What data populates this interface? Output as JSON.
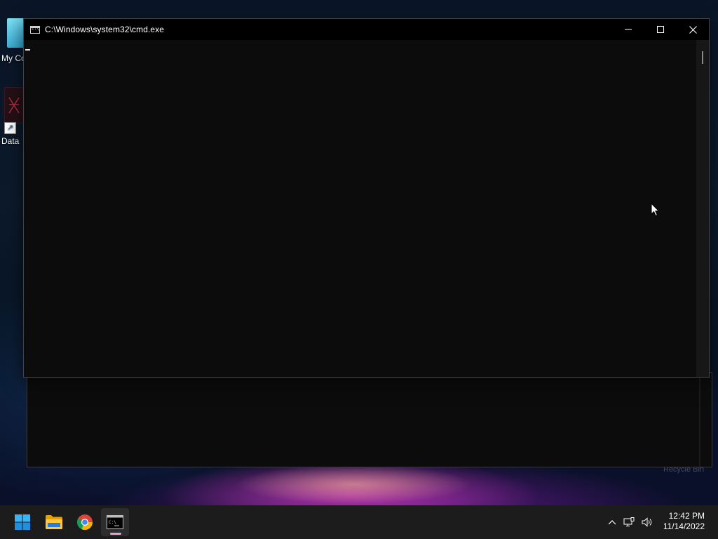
{
  "desktop": {
    "icons": [
      {
        "label": "My Co",
        "icon": "monitor-icon"
      },
      {
        "label": "Data",
        "icon": "database-shortcut-icon"
      }
    ],
    "recycle_bin_label": "Recycle Bin"
  },
  "cmd_window": {
    "title": "C:\\Windows\\system32\\cmd.exe",
    "console_text": "",
    "controls": {
      "minimize": "minimize-icon",
      "maximize": "maximize-icon",
      "close": "close-icon"
    }
  },
  "taskbar": {
    "apps": [
      {
        "name": "Start",
        "icon": "windows-start-icon"
      },
      {
        "name": "File Explorer",
        "icon": "folder-icon"
      },
      {
        "name": "Google Chrome",
        "icon": "chrome-icon"
      },
      {
        "name": "Command Prompt",
        "icon": "cmd-icon",
        "active": true
      }
    ],
    "tray_icons": [
      "chevron-up-icon",
      "network-icon",
      "speaker-icon"
    ],
    "clock": {
      "time": "12:42 PM",
      "date": "11/14/2022"
    }
  },
  "colors": {
    "console_bg": "#0c0c0c",
    "titlebar_bg": "#000000",
    "taskbar_bg": "#1c1c1c",
    "active_indicator": "#e1a3c9"
  }
}
